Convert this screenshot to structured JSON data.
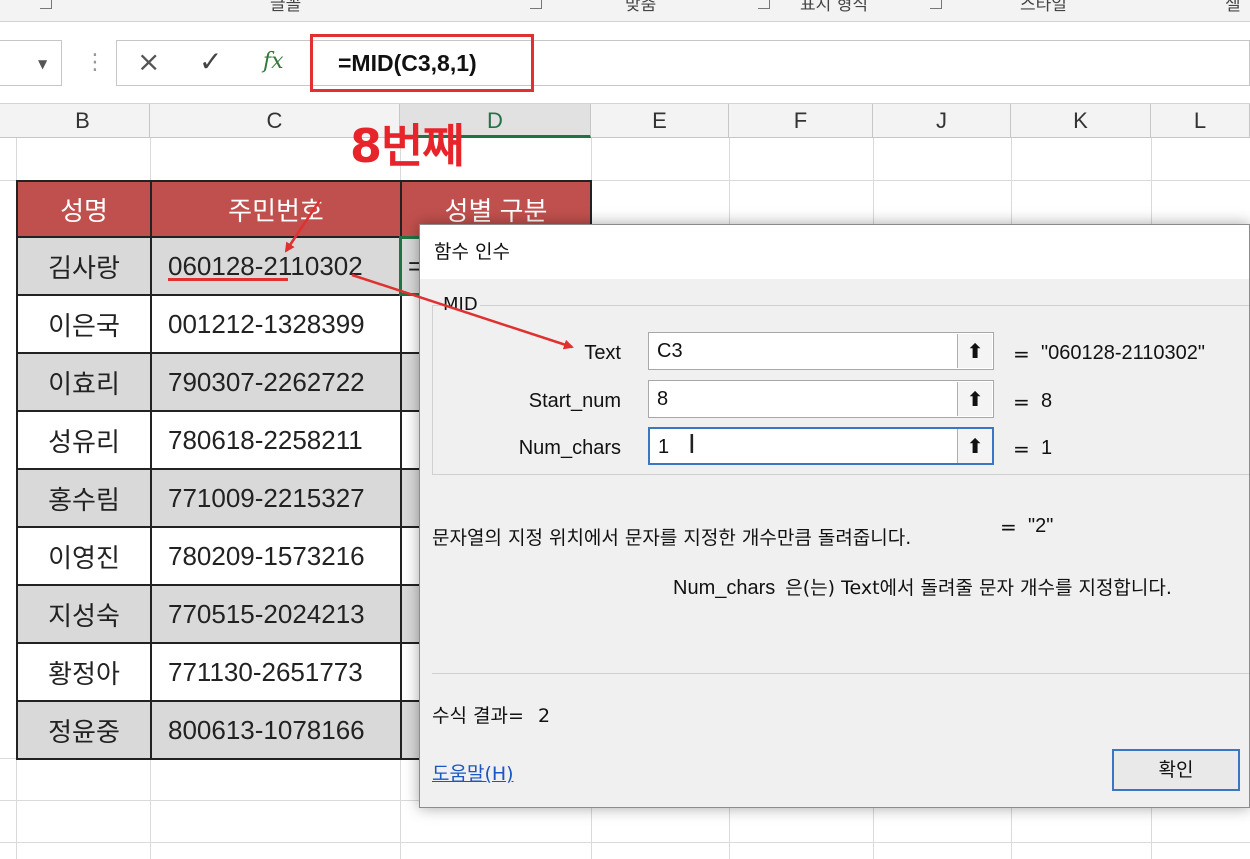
{
  "ribbon": {
    "groups": [
      "글꼴",
      "맞춤",
      "표시 형식",
      "스타일",
      "셀"
    ]
  },
  "formula_bar": {
    "cancel_icon": "×",
    "enter_icon": "✓",
    "fx_label": "fx",
    "formula": "=MID(C3,8,1)"
  },
  "columns": [
    "B",
    "C",
    "D",
    "E",
    "F",
    "J",
    "K",
    "L"
  ],
  "annotation": {
    "label": "8번째",
    "color": "#e8242b"
  },
  "table": {
    "headers": [
      "성명",
      "주민번호",
      "성별 구분"
    ],
    "header_color": "#c0504d",
    "rows": [
      {
        "name": "김사랑",
        "id": "060128-2110302",
        "gender": "="
      },
      {
        "name": "이은국",
        "id": "001212-1328399",
        "gender": ""
      },
      {
        "name": "이효리",
        "id": "790307-2262722",
        "gender": ""
      },
      {
        "name": "성유리",
        "id": "780618-2258211",
        "gender": ""
      },
      {
        "name": "홍수림",
        "id": "771009-2215327",
        "gender": ""
      },
      {
        "name": "이영진",
        "id": "780209-1573216",
        "gender": ""
      },
      {
        "name": "지성숙",
        "id": "770515-2024213",
        "gender": ""
      },
      {
        "name": "황정아",
        "id": "771130-2651773",
        "gender": ""
      },
      {
        "name": "정윤중",
        "id": "800613-1078166",
        "gender": ""
      }
    ]
  },
  "dialog": {
    "title": "함수 인수",
    "function_name": "MID",
    "args": [
      {
        "label": "Text",
        "value": "C3",
        "eq": "=",
        "result": "\"060128-2110302\""
      },
      {
        "label": "Start_num",
        "value": "8",
        "eq": "=",
        "result": "8"
      },
      {
        "label": "Num_chars",
        "value": "1",
        "eq": "=",
        "result": "1"
      }
    ],
    "collapse_icon": "⬆",
    "overall_eq": "=",
    "overall_result": "\"2\"",
    "description": "문자열의 지정 위치에서 문자를 지정한 개수만큼 돌려줍니다.",
    "arg_description_name": "Num_chars",
    "arg_description": "은(는) Text에서 돌려줄 문자 개수를 지정합니다.",
    "result_label": "수식 결과=",
    "result_value": "2",
    "help_link": "도움말(H)",
    "ok_label": "확인"
  }
}
